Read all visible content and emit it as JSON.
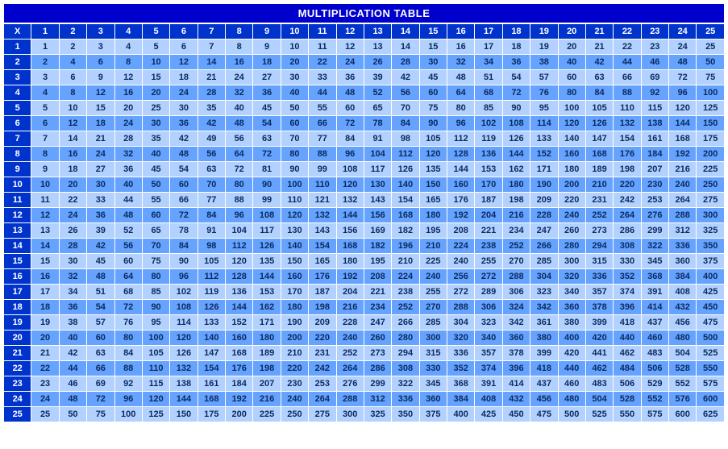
{
  "title": "MULTIPLICATION TABLE",
  "corner": "X",
  "size": 25,
  "chart_data": {
    "type": "table",
    "title": "MULTIPLICATION TABLE",
    "row_headers": [
      1,
      2,
      3,
      4,
      5,
      6,
      7,
      8,
      9,
      10,
      11,
      12,
      13,
      14,
      15,
      16,
      17,
      18,
      19,
      20,
      21,
      22,
      23,
      24,
      25
    ],
    "col_headers": [
      1,
      2,
      3,
      4,
      5,
      6,
      7,
      8,
      9,
      10,
      11,
      12,
      13,
      14,
      15,
      16,
      17,
      18,
      19,
      20,
      21,
      22,
      23,
      24,
      25
    ],
    "values": [
      [
        1,
        2,
        3,
        4,
        5,
        6,
        7,
        8,
        9,
        10,
        11,
        12,
        13,
        14,
        15,
        16,
        17,
        18,
        19,
        20,
        21,
        22,
        23,
        24,
        25
      ],
      [
        2,
        4,
        6,
        8,
        10,
        12,
        14,
        16,
        18,
        20,
        22,
        24,
        26,
        28,
        30,
        32,
        34,
        36,
        38,
        40,
        42,
        44,
        46,
        48,
        50
      ],
      [
        3,
        6,
        9,
        12,
        15,
        18,
        21,
        24,
        27,
        30,
        33,
        36,
        39,
        42,
        45,
        48,
        51,
        54,
        57,
        60,
        63,
        66,
        69,
        72,
        75
      ],
      [
        4,
        8,
        12,
        16,
        20,
        24,
        28,
        32,
        36,
        40,
        44,
        48,
        52,
        56,
        60,
        64,
        68,
        72,
        76,
        80,
        84,
        88,
        92,
        96,
        100
      ],
      [
        5,
        10,
        15,
        20,
        25,
        30,
        35,
        40,
        45,
        50,
        55,
        60,
        65,
        70,
        75,
        80,
        85,
        90,
        95,
        100,
        105,
        110,
        115,
        120,
        125
      ],
      [
        6,
        12,
        18,
        24,
        30,
        36,
        42,
        48,
        54,
        60,
        66,
        72,
        78,
        84,
        90,
        96,
        102,
        108,
        114,
        120,
        126,
        132,
        138,
        144,
        150
      ],
      [
        7,
        14,
        21,
        28,
        35,
        42,
        49,
        56,
        63,
        70,
        77,
        84,
        91,
        98,
        105,
        112,
        119,
        126,
        133,
        140,
        147,
        154,
        161,
        168,
        175
      ],
      [
        8,
        16,
        24,
        32,
        40,
        48,
        56,
        64,
        72,
        80,
        88,
        96,
        104,
        112,
        120,
        128,
        136,
        144,
        152,
        160,
        168,
        176,
        184,
        192,
        200
      ],
      [
        9,
        18,
        27,
        36,
        45,
        54,
        63,
        72,
        81,
        90,
        99,
        108,
        117,
        126,
        135,
        144,
        153,
        162,
        171,
        180,
        189,
        198,
        207,
        216,
        225
      ],
      [
        10,
        20,
        30,
        40,
        50,
        60,
        70,
        80,
        90,
        100,
        110,
        120,
        130,
        140,
        150,
        160,
        170,
        180,
        190,
        200,
        210,
        220,
        230,
        240,
        250
      ],
      [
        11,
        22,
        33,
        44,
        55,
        66,
        77,
        88,
        99,
        110,
        121,
        132,
        143,
        154,
        165,
        176,
        187,
        198,
        209,
        220,
        231,
        242,
        253,
        264,
        275
      ],
      [
        12,
        24,
        36,
        48,
        60,
        72,
        84,
        96,
        108,
        120,
        132,
        144,
        156,
        168,
        180,
        192,
        204,
        216,
        228,
        240,
        252,
        264,
        276,
        288,
        300
      ],
      [
        13,
        26,
        39,
        52,
        65,
        78,
        91,
        104,
        117,
        130,
        143,
        156,
        169,
        182,
        195,
        208,
        221,
        234,
        247,
        260,
        273,
        286,
        299,
        312,
        325
      ],
      [
        14,
        28,
        42,
        56,
        70,
        84,
        98,
        112,
        126,
        140,
        154,
        168,
        182,
        196,
        210,
        224,
        238,
        252,
        266,
        280,
        294,
        308,
        322,
        336,
        350
      ],
      [
        15,
        30,
        45,
        60,
        75,
        90,
        105,
        120,
        135,
        150,
        165,
        180,
        195,
        210,
        225,
        240,
        255,
        270,
        285,
        300,
        315,
        330,
        345,
        360,
        375
      ],
      [
        16,
        32,
        48,
        64,
        80,
        96,
        112,
        128,
        144,
        160,
        176,
        192,
        208,
        224,
        240,
        256,
        272,
        288,
        304,
        320,
        336,
        352,
        368,
        384,
        400
      ],
      [
        17,
        34,
        51,
        68,
        85,
        102,
        119,
        136,
        153,
        170,
        187,
        204,
        221,
        238,
        255,
        272,
        289,
        306,
        323,
        340,
        357,
        374,
        391,
        408,
        425
      ],
      [
        18,
        36,
        54,
        72,
        90,
        108,
        126,
        144,
        162,
        180,
        198,
        216,
        234,
        252,
        270,
        288,
        306,
        324,
        342,
        360,
        378,
        396,
        414,
        432,
        450
      ],
      [
        19,
        38,
        57,
        76,
        95,
        114,
        133,
        152,
        171,
        190,
        209,
        228,
        247,
        266,
        285,
        304,
        323,
        342,
        361,
        380,
        399,
        418,
        437,
        456,
        475
      ],
      [
        20,
        40,
        60,
        80,
        100,
        120,
        140,
        160,
        180,
        200,
        220,
        240,
        260,
        280,
        300,
        320,
        340,
        360,
        380,
        400,
        420,
        440,
        460,
        480,
        500
      ],
      [
        21,
        42,
        63,
        84,
        105,
        126,
        147,
        168,
        189,
        210,
        231,
        252,
        273,
        294,
        315,
        336,
        357,
        378,
        399,
        420,
        441,
        462,
        483,
        504,
        525
      ],
      [
        22,
        44,
        66,
        88,
        110,
        132,
        154,
        176,
        198,
        220,
        242,
        264,
        286,
        308,
        330,
        352,
        374,
        396,
        418,
        440,
        462,
        484,
        506,
        528,
        550
      ],
      [
        23,
        46,
        69,
        92,
        115,
        138,
        161,
        184,
        207,
        230,
        253,
        276,
        299,
        322,
        345,
        368,
        391,
        414,
        437,
        460,
        483,
        506,
        529,
        552,
        575
      ],
      [
        24,
        48,
        72,
        96,
        120,
        144,
        168,
        192,
        216,
        240,
        264,
        288,
        312,
        336,
        360,
        384,
        408,
        432,
        456,
        480,
        504,
        528,
        552,
        576,
        600
      ],
      [
        25,
        50,
        75,
        100,
        125,
        150,
        175,
        200,
        225,
        250,
        275,
        300,
        325,
        350,
        375,
        400,
        425,
        450,
        475,
        500,
        525,
        550,
        575,
        600,
        625
      ]
    ]
  }
}
